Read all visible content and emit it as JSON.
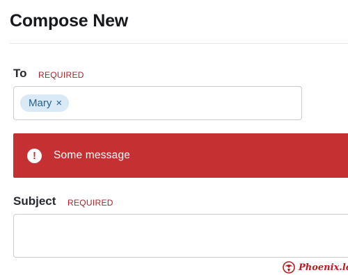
{
  "header": {
    "title": "Compose New"
  },
  "to": {
    "label": "To",
    "required": "REQUIRED",
    "recipients": [
      {
        "name": "Mary",
        "remove": "×"
      }
    ]
  },
  "alert": {
    "icon": "exclamation-icon",
    "glyph": "!",
    "message": "Some message",
    "color": "#c53032"
  },
  "subject": {
    "label": "Subject",
    "required": "REQUIRED",
    "value": ""
  },
  "watermark": {
    "text": "Phoenix.lol"
  },
  "colors": {
    "required": "#b01e24",
    "chip_bg": "#d9e9f5",
    "chip_text": "#22618f"
  }
}
